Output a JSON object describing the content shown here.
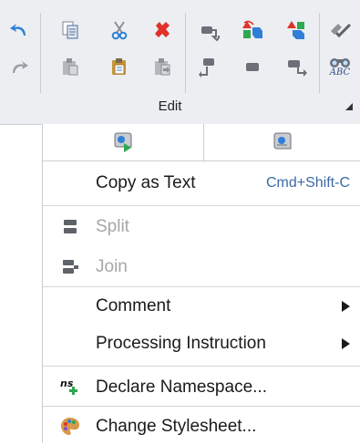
{
  "ribbon": {
    "group_label": "Edit",
    "icons": {
      "undo": "undo-icon",
      "redo": "redo-icon",
      "copy": "copy-icon",
      "paste": "paste-icon",
      "cut": "scissors-icon",
      "paste_special": "paste-special-icon",
      "delete": "delete-icon",
      "paste_as": "paste-as-icon",
      "spell_check": "spell-check-icon",
      "find": "binoculars-abc-icon"
    },
    "find_icon_text": "ABC"
  },
  "context_menu": {
    "top_buttons": [
      "scroll-run-icon",
      "scroll-settings-icon"
    ],
    "copy_as_text": {
      "label": "Copy as Text",
      "shortcut": "Cmd+Shift-C"
    },
    "split": {
      "label": "Split",
      "enabled": false
    },
    "join": {
      "label": "Join",
      "enabled": false
    },
    "comment": {
      "label": "Comment",
      "has_submenu": true
    },
    "processing_instruction": {
      "label": "Processing Instruction",
      "has_submenu": true
    },
    "declare_namespace": {
      "label": "Declare Namespace...",
      "icon_text": "ns"
    },
    "change_stylesheet": {
      "label": "Change Stylesheet..."
    }
  },
  "colors": {
    "ribbon_bg": "#eceef1",
    "shortcut": "#3d6aa5",
    "disabled": "#a6a6a6",
    "accent_blue": "#2f7fd6",
    "delete_red": "#e0322a"
  }
}
